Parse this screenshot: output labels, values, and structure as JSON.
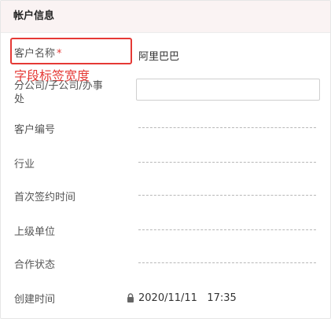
{
  "section": {
    "title": "帐户信息"
  },
  "annotation": {
    "text": "字段标签宽度"
  },
  "fields": {
    "customer_name": {
      "label": "客户名称",
      "required_mark": "*",
      "value": "阿里巴巴"
    },
    "branch": {
      "label_line1": "分公司/子公司/办事",
      "label_line2": "处",
      "value": ""
    },
    "customer_number": {
      "label": "客户编号"
    },
    "industry": {
      "label": "行业"
    },
    "first_contract_time": {
      "label": "首次签约时间"
    },
    "parent_unit": {
      "label": "上级单位"
    },
    "cooperation_status": {
      "label": "合作状态"
    },
    "created_time": {
      "label": "创建时间",
      "value": "2020/11/11   17:35"
    }
  },
  "icons": {
    "lock": "lock-icon"
  },
  "colors": {
    "accent_red": "#e53935",
    "header_bg": "#faf3f3"
  }
}
